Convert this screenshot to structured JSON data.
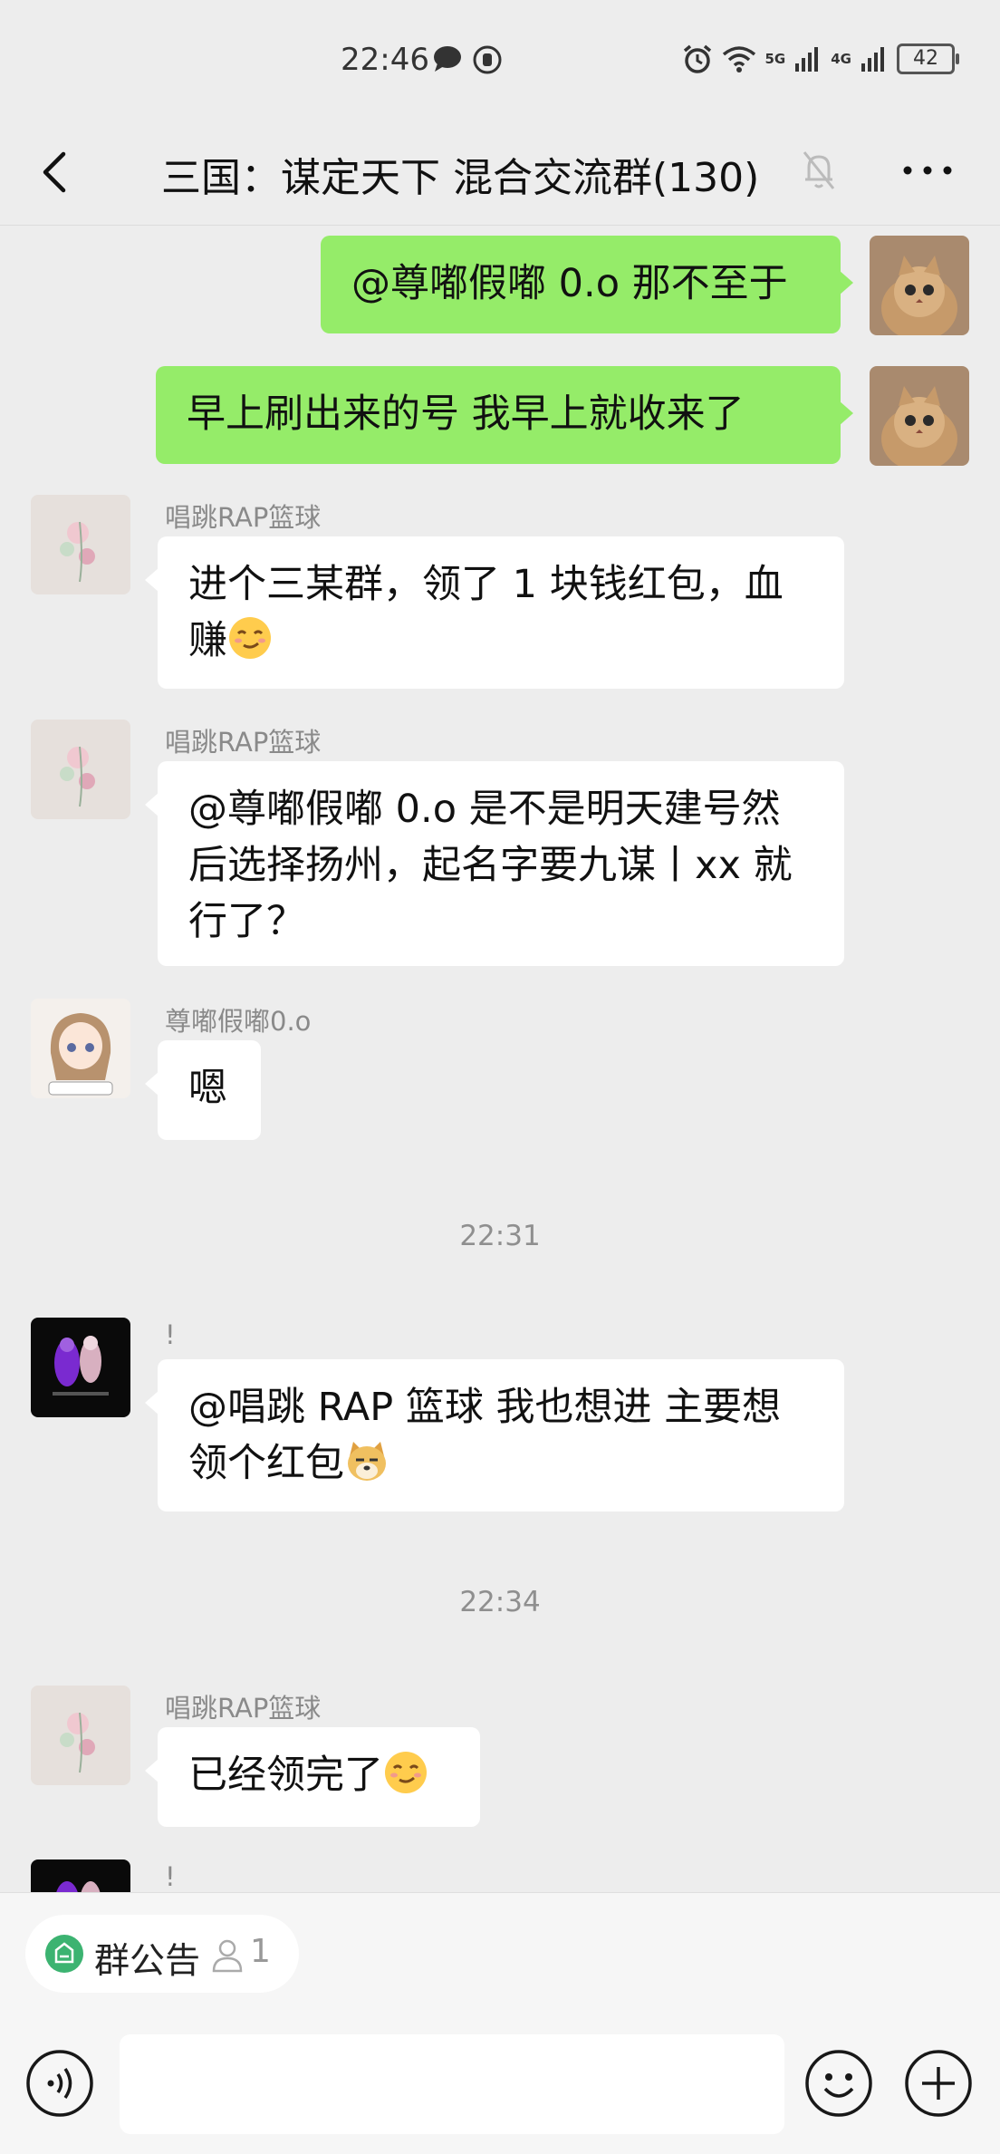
{
  "status_bar": {
    "time": "22:46",
    "battery": "42",
    "net_5g": "5G",
    "net_4g": "4G"
  },
  "header": {
    "title": "三国：谋定天下 混合交流群(130)"
  },
  "messages": [
    {
      "side": "out",
      "text": "@尊嘟假嘟 0.o  那不至于"
    },
    {
      "side": "out",
      "text": "早上刷出来的号 我早上就收来了"
    },
    {
      "side": "in",
      "sender": "唱跳RAP篮球",
      "text": "进个三某群，领了 1 块钱红包，血赚",
      "emoji": "smirk-face"
    },
    {
      "side": "in",
      "sender": "唱跳RAP篮球",
      "text": "@尊嘟假嘟 0.o  是不是明天建号然后选择扬州，起名字要九谋丨xx 就行了？"
    },
    {
      "side": "in",
      "sender": "尊嘟假嘟0.o",
      "text": "嗯"
    },
    {
      "side": "in",
      "sender": "!",
      "text": "@唱跳 RAP 篮球  我也想进 主要想领个红包",
      "emoji": "doge"
    },
    {
      "side": "in",
      "sender": "唱跳RAP篮球",
      "text": "已经领完了",
      "emoji": "smirk-face"
    },
    {
      "side": "in",
      "sender": "!"
    }
  ],
  "time_separators": [
    "22:31",
    "22:34"
  ],
  "bottom": {
    "notice_label": "群公告",
    "notice_count": "1"
  },
  "colors": {
    "background": "#ededed",
    "bubble_out": "#95ec69",
    "bubble_in": "#ffffff",
    "notice_icon": "#3cb371"
  }
}
